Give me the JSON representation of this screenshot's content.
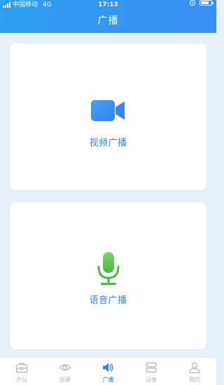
{
  "status_bar": {
    "carrier": "中国移动",
    "network": "4G",
    "time": "17:13"
  },
  "header": {
    "title": "广播"
  },
  "cards": [
    {
      "label": "视频广播",
      "icon": "video-camera-icon"
    },
    {
      "label": "语音广播",
      "icon": "microphone-icon"
    }
  ],
  "tabbar": {
    "items": [
      {
        "label": "办公",
        "icon": "briefcase-icon",
        "active": false
      },
      {
        "label": "巡课",
        "icon": "eye-icon",
        "active": false
      },
      {
        "label": "广播",
        "icon": "speaker-icon",
        "active": true
      },
      {
        "label": "设备",
        "icon": "device-icon",
        "active": false
      },
      {
        "label": "我的",
        "icon": "user-icon",
        "active": false
      }
    ]
  },
  "colors": {
    "header_start": "#2f9ff0",
    "header_end": "#3a8ef5",
    "background": "#e6f1fb",
    "accent": "#2f86e6",
    "mic_green": "#5cc44f",
    "inactive": "#b4b4b4"
  }
}
